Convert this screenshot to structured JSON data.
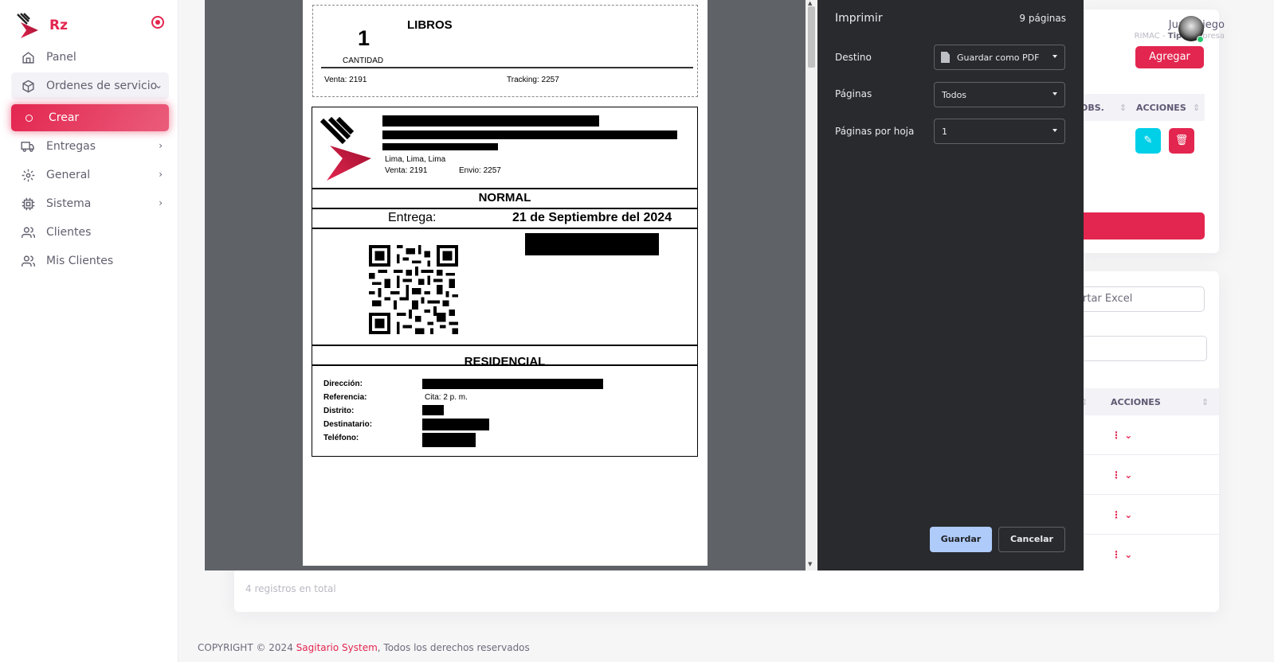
{
  "brand": {
    "name": "Rz"
  },
  "sidebar": {
    "items": [
      {
        "label": "Panel",
        "icon": "home-icon"
      },
      {
        "label": "Ordenes de servicio",
        "icon": "package-icon"
      },
      {
        "label": "Crear",
        "icon": "circle-icon"
      },
      {
        "label": "Entregas",
        "icon": "truck-icon"
      },
      {
        "label": "General",
        "icon": "gear-icon"
      },
      {
        "label": "Sistema",
        "icon": "cpu-icon"
      },
      {
        "label": "Clientes",
        "icon": "users-icon"
      },
      {
        "label": "Mis Clientes",
        "icon": "users-icon"
      }
    ]
  },
  "user": {
    "name": "Juan Diego",
    "role_prefix": "RIMAC - ",
    "role_bold": "Tipo",
    "role_suffix": " Empresa"
  },
  "toolbar": {
    "agregar_label": "Agregar"
  },
  "table1": {
    "col_obs": "OBS.",
    "col_acciones": "ACCIONES"
  },
  "excel": {
    "value": "rtar Excel"
  },
  "table2": {
    "col_acciones": "ACCIONES",
    "row_count": 4
  },
  "registros": "4 registros en total",
  "footer": {
    "prefix": "COPYRIGHT © 2024 ",
    "brand": "Sagitario System",
    "suffix": ", Todos los derechos reservados"
  },
  "print": {
    "title": "Imprimir",
    "pages_count": "9 páginas",
    "destino_label": "Destino",
    "destino_value": "Guardar como PDF",
    "paginas_label": "Páginas",
    "paginas_value": "Todos",
    "por_hoja_label": "Páginas por hoja",
    "por_hoja_value": "1",
    "save_label": "Guardar",
    "cancel_label": "Cancelar"
  },
  "label": {
    "cantidad": "1",
    "cantidad_label": "CANTIDAD",
    "producto": "LIBROS",
    "venta": "Venta: 2191",
    "tracking": "Tracking: 2257",
    "ciudad": "Lima, Lima, Lima",
    "envio": "Envio: 2257",
    "tipo": "NORMAL",
    "entrega_label": "Entrega:",
    "entrega_fecha": "21 de Septiembre del 2024",
    "zona": "RESIDENCIAL",
    "direccion": "Dirección:",
    "referencia": "Referencia:",
    "referencia_val": "Cita: 2 p. m.",
    "distrito": "Distrito:",
    "destinatario": "Destinatario:",
    "telefono": "Teléfono:"
  },
  "colors": {
    "accent": "#e3264f",
    "dialog_bg": "#292a2d",
    "preview_bg": "#5f6368",
    "primary_btn": "#aecbfa"
  }
}
